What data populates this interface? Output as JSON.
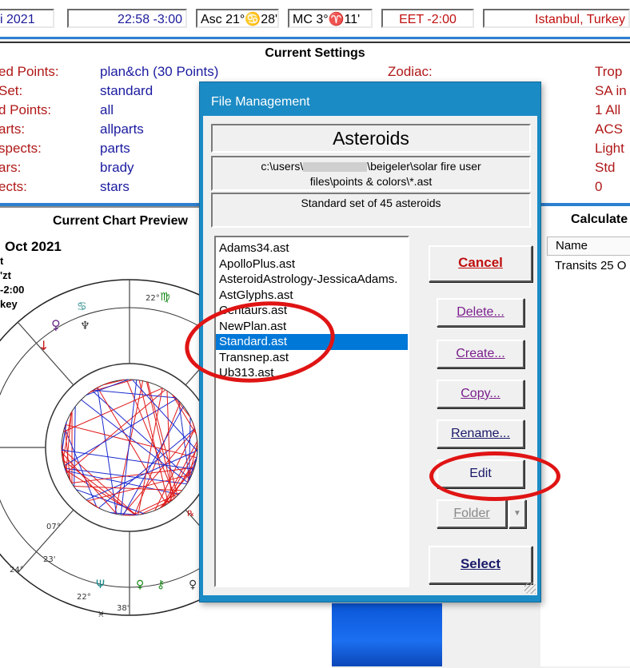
{
  "topbar": {
    "date": "i 2021",
    "time": "22:58  -3:00",
    "asc": "Asc 21°♋28'",
    "mc": "MC 3°♈11'",
    "tz": "EET -2:00",
    "place": "Istanbul, Turkey"
  },
  "settings": {
    "title": "Current Settings",
    "rows": [
      {
        "label": "ed Points:",
        "value": "plan&ch  (30 Points)"
      },
      {
        "label": "Set:",
        "value": "standard"
      },
      {
        "label": "d Points:",
        "value": "all"
      },
      {
        "label": "arts:",
        "value": "allparts"
      },
      {
        "label": "spects:",
        "value": "parts"
      },
      {
        "label": "ars:",
        "value": "brady"
      },
      {
        "label": "ects:",
        "value": "stars"
      }
    ],
    "right_rows": [
      {
        "label": "Zodiac:",
        "value": "Trop"
      },
      {
        "label": "",
        "value": "SA in"
      },
      {
        "label": "",
        "value": "1 All"
      },
      {
        "label": "",
        "value": "ACS"
      },
      {
        "label": "",
        "value": "Light"
      },
      {
        "label": "",
        "value": "Std"
      },
      {
        "label": "",
        "value": "0"
      }
    ]
  },
  "chart_preview": {
    "title": "Current Chart Preview",
    "lines": [
      "Oct 2021",
      "t",
      "'zt",
      "-2:00",
      "key"
    ]
  },
  "calculated": {
    "title": "Calculate",
    "column": "Name",
    "row": "Transits 25 O"
  },
  "dialog": {
    "title": "File Management",
    "heading": "Asteroids",
    "path_line1": "c:\\users\\",
    "path_redacted_end": "\\beigeler\\solar fire user",
    "path_line2": "files\\points & colors\\*.ast",
    "description": "Standard set of 45 asteroids",
    "files": [
      "Adams34.ast",
      "ApolloPlus.ast",
      "AsteroidAstrology-JessicaAdams.",
      "AstGlyphs.ast",
      "Centaurs.ast",
      "NewPlan.ast",
      "Standard.ast",
      "Transnep.ast",
      "Ub313.ast"
    ],
    "selected_index": 6,
    "buttons": {
      "cancel": "Cancel",
      "delete": "Delete...",
      "create": "Create...",
      "copy": "Copy...",
      "rename": "Rename...",
      "edit": "Edit",
      "folder": "Folder",
      "select": "Select"
    }
  }
}
